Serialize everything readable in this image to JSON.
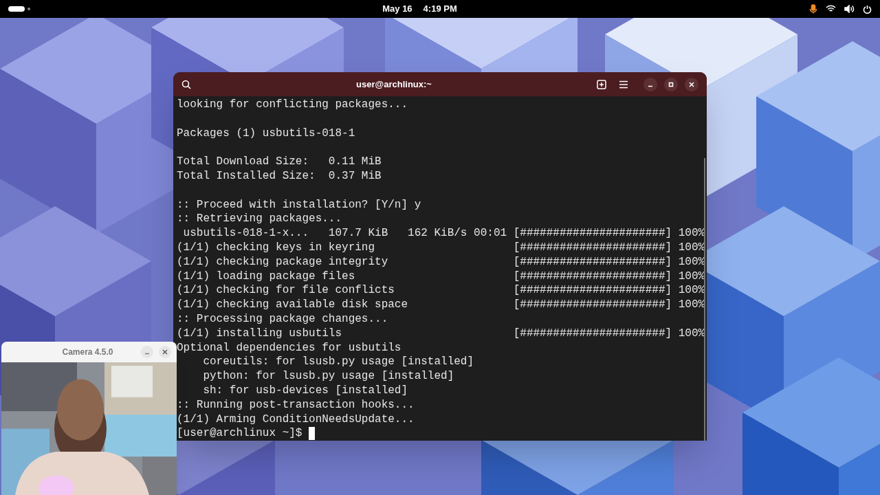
{
  "top_bar": {
    "date": "May 16",
    "time": "4:19 PM",
    "mic_active": true
  },
  "terminal": {
    "title": "user@archlinux:~",
    "blocks": [
      [
        "looking for conflicting packages..."
      ],
      [
        "Packages (1) usbutils-018-1"
      ],
      [
        "Total Download Size:   0.11 MiB",
        "Total Installed Size:  0.37 MiB"
      ],
      [
        ":: Proceed with installation? [Y/n] y",
        ":: Retrieving packages...",
        " usbutils-018-1-x...   107.7 KiB   162 KiB/s 00:01 [######################] 100%",
        "(1/1) checking keys in keyring                     [######################] 100%",
        "(1/1) checking package integrity                   [######################] 100%",
        "(1/1) loading package files                        [######################] 100%",
        "(1/1) checking for file conflicts                  [######################] 100%",
        "(1/1) checking available disk space                [######################] 100%",
        ":: Processing package changes...",
        "(1/1) installing usbutils                          [######################] 100%",
        "Optional dependencies for usbutils",
        "    coreutils: for lsusb.py usage [installed]",
        "    python: for lsusb.py usage [installed]",
        "    sh: for usb-devices [installed]",
        ":: Running post-transaction hooks...",
        "(1/1) Arming ConditionNeedsUpdate..."
      ]
    ],
    "prompt": "[user@archlinux ~]$ "
  },
  "camera": {
    "title": "Camera 4.5.0"
  }
}
